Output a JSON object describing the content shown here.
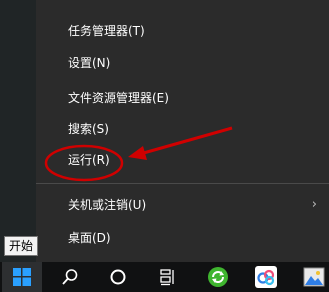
{
  "context_menu": {
    "items": [
      {
        "label": "任务管理器(T)"
      },
      {
        "label": "设置(N)"
      },
      {
        "label": "文件资源管理器(E)"
      },
      {
        "label": "搜索(S)"
      },
      {
        "label": "运行(R)"
      },
      {
        "label": "关机或注销(U)",
        "has_submenu": true,
        "submenu_arrow": "›"
      },
      {
        "label": "桌面(D)"
      }
    ]
  },
  "tooltip": {
    "text": "开始"
  },
  "taskbar": {
    "buttons": [
      {
        "icon": "windows-logo-icon"
      },
      {
        "icon": "search-icon"
      },
      {
        "icon": "cortana-circle-icon"
      },
      {
        "icon": "task-view-icon"
      },
      {
        "icon": "green-refresh-app-icon"
      },
      {
        "icon": "blue-cloud-app-icon"
      },
      {
        "icon": "image-app-icon"
      }
    ]
  },
  "annotation": {
    "highlight_color": "#d00000",
    "target": "运行(R)"
  }
}
